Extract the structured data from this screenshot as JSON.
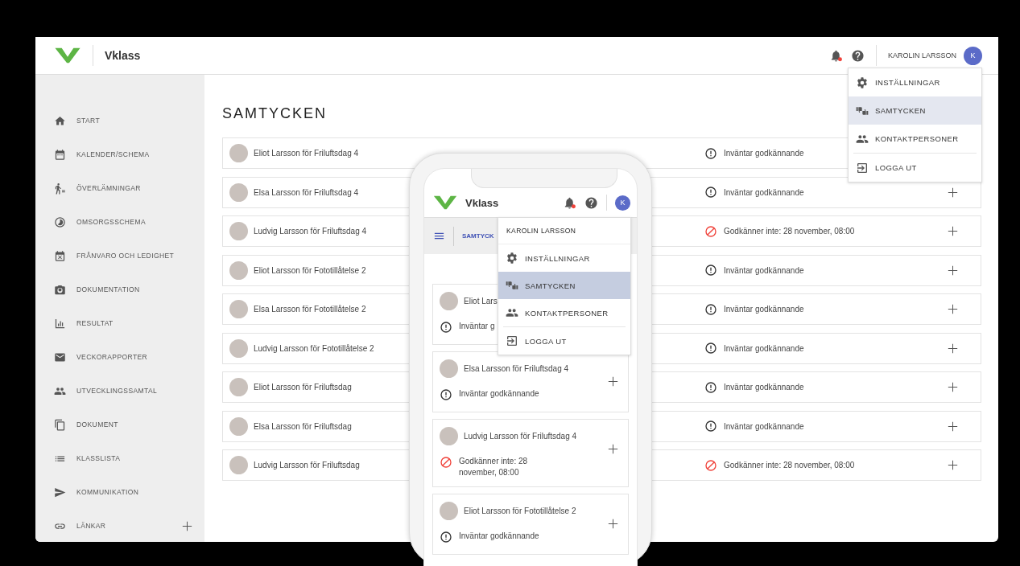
{
  "app_header": {
    "logo_text": "Vklass",
    "has_notification": true,
    "user_name": "KAROLIN LARSSON",
    "avatar_initial": "K"
  },
  "user_menu": {
    "items": [
      {
        "kind": "settings",
        "label": "INSTÄLLNINGAR",
        "selected": false
      },
      {
        "kind": "consents",
        "label": "SAMTYCKEN",
        "selected": true
      },
      {
        "kind": "contacts",
        "label": "KONTAKTPERSONER",
        "selected": false
      },
      {
        "kind": "logout",
        "label": "LOGGA UT",
        "selected": false
      }
    ]
  },
  "sidebar": {
    "items": [
      {
        "kind": "home",
        "label": "START",
        "addable": false
      },
      {
        "kind": "calendar",
        "label": "KALENDER/SCHEMA",
        "addable": false
      },
      {
        "kind": "handover",
        "label": "ÖVERLÄMNINGAR",
        "addable": false
      },
      {
        "kind": "care",
        "label": "OMSORGSSCHEMA",
        "addable": false
      },
      {
        "kind": "absence",
        "label": "FRÅNVARO OCH LEDIGHET",
        "addable": false
      },
      {
        "kind": "camera",
        "label": "DOKUMENTATION",
        "addable": false
      },
      {
        "kind": "results",
        "label": "RESULTAT",
        "addable": false
      },
      {
        "kind": "mail",
        "label": "VECKORAPPORTER",
        "addable": false
      },
      {
        "kind": "people",
        "label": "UTVECKLINGSSAMTAL",
        "addable": false
      },
      {
        "kind": "documents",
        "label": "DOKUMENT",
        "addable": false
      },
      {
        "kind": "list",
        "label": "KLASSLISTA",
        "addable": false
      },
      {
        "kind": "send",
        "label": "KOMMUNIKATION",
        "addable": false
      },
      {
        "kind": "link",
        "label": "LÄNKAR",
        "addable": true
      }
    ]
  },
  "page": {
    "title": "SAMTYCKEN",
    "rows": [
      {
        "name": "Eliot Larsson för Friluftsdag 4",
        "kind": "pending",
        "status": "Inväntar godkännande"
      },
      {
        "name": "Elsa Larsson för Friluftsdag 4",
        "kind": "pending",
        "status": "Inväntar godkännande"
      },
      {
        "name": "Ludvig Larsson för Friluftsdag 4",
        "kind": "declined",
        "status": "Godkänner inte: 28 november, 08:00"
      },
      {
        "name": "Eliot Larsson för Fototillåtelse 2",
        "kind": "pending",
        "status": "Inväntar godkännande"
      },
      {
        "name": "Elsa Larsson för Fototillåtelse 2",
        "kind": "pending",
        "status": "Inväntar godkännande"
      },
      {
        "name": "Ludvig Larsson för Fototillåtelse 2",
        "kind": "pending",
        "status": "Inväntar godkännande"
      },
      {
        "name": "Eliot Larsson för Friluftsdag",
        "kind": "pending",
        "status": "Inväntar godkännande"
      },
      {
        "name": "Elsa Larsson för Friluftsdag",
        "kind": "pending",
        "status": "Inväntar godkännande"
      },
      {
        "name": "Ludvig Larsson för Friluftsdag",
        "kind": "declined",
        "status": "Godkänner inte: 28 november, 08:00"
      }
    ]
  },
  "phone": {
    "header": {
      "logo_text": "Vklass",
      "has_notification": true,
      "avatar_initial": "K"
    },
    "breadcrumb": "SAMTYCK",
    "menu": {
      "header": "KAROLIN LARSSON",
      "items": [
        {
          "kind": "settings",
          "label": "INSTÄLLNINGAR",
          "selected": false
        },
        {
          "kind": "consents",
          "label": "SAMTYCKEN",
          "selected": true
        },
        {
          "kind": "contacts",
          "label": "KONTAKTPERSONER",
          "selected": false
        },
        {
          "kind": "logout",
          "label": "LOGGA UT",
          "selected": false
        }
      ]
    },
    "cards": [
      {
        "name": "Eliot Lars",
        "kind": "pending",
        "status": "Inväntar g"
      },
      {
        "name": "Elsa Larsson för Friluftsdag 4",
        "kind": "pending",
        "status": "Inväntar godkännande"
      },
      {
        "name": "Ludvig Larsson för Friluftsdag 4",
        "kind": "declined",
        "status": "Godkänner inte: 28 november, 08:00"
      },
      {
        "name": "Eliot Larsson för Fototillåtelse 2",
        "kind": "pending",
        "status": "Inväntar godkännande"
      }
    ]
  }
}
